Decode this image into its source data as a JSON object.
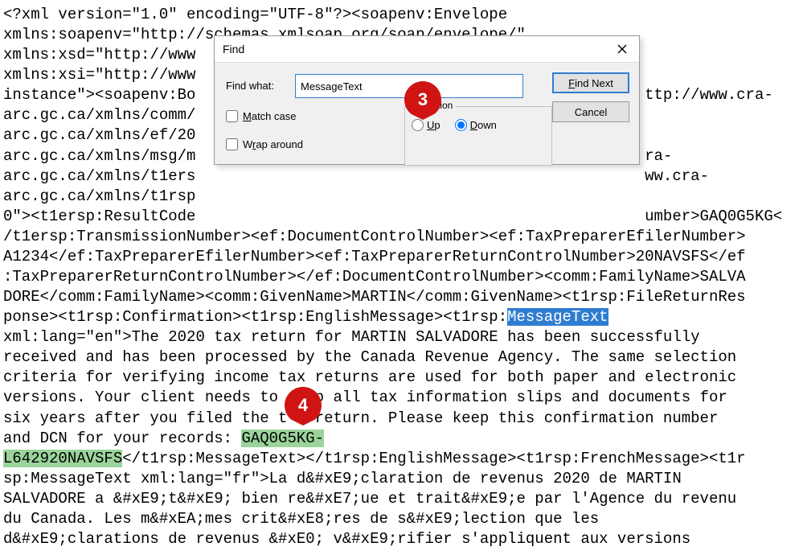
{
  "document_text_pre1": "<?xml version=\"1.0\" encoding=\"UTF-8\"?><soapenv:Envelope\nxmlns:soapenv=\"http://schemas.xmlsoap.org/soap/envelope/\"\nxmlns:xsd=\"http://www\nxmlns:xsi=\"http://www\ninstance\"><soapenv:Bo                                                 ttp://www.cra-\narc.gc.ca/xmlns/comm/\narc.gc.ca/xmlns/ef/20\narc.gc.ca/xmlns/msg/m                                                 ra-\narc.gc.ca/xmlns/t1ers                                                 ww.cra-\narc.gc.ca/xmlns/t1rsp\n0\"><t1ersp:ResultCode                                                 umber>GAQ0G5KG<\n/t1ersp:TransmissionNumber><ef:DocumentControlNumber><ef:TaxPreparerEfilerNumber>\nA1234</ef:TaxPreparerEfilerNumber><ef:TaxPreparerReturnControlNumber>20NAVSFS</ef\n:TaxPreparerReturnControlNumber></ef:DocumentControlNumber><comm:FamilyName>SALVA\nDORE</comm:FamilyName><comm:GivenName>MARTIN</comm:GivenName><t1rsp:FileReturnRes\nponse><t1rsp:Confirmation><t1rsp:EnglishMessage><t1rsp:",
  "highlight_blue": "MessageText",
  "document_text_mid1": "\nxml:lang=\"en\">The 2020 tax return for MARTIN SALVADORE has been successfully\nreceived and has been processed by the Canada Revenue Agency. The same selection\ncriteria for verifying income tax returns are used for both paper and electronic\nversions. Your client needs to    p all tax information slips and documents for\nsix years after you filed the t   return. Please keep this confirmation number\nand DCN for your records: ",
  "highlight_green": "GAQ0G5KG-\nL642920NAVSFS",
  "document_text_post1": "</t1rsp:MessageText></t1rsp:EnglishMessage><t1rsp:FrenchMessage><t1r\nsp:MessageText xml:lang=\"fr\">La d&#xE9;claration de revenus 2020 de MARTIN\nSALVADORE a &#xE9;t&#xE9; bien re&#xE7;ue et trait&#xE9;e par l'Agence du revenu\ndu Canada. Les m&#xEA;mes crit&#xE8;res de s&#xE9;lection que les\nd&#xE9;clarations de revenus &#xE0; v&#xE9;rifier s'appliquent aux versions",
  "find_dialog": {
    "title": "Find",
    "find_what_label": "Find what:",
    "find_what_value": "MessageText",
    "match_case_label": "Match case",
    "wrap_around_label": "Wrap around",
    "direction_label": "Direction",
    "up_label": "Up",
    "down_label": "Down",
    "find_next_pre": "F",
    "find_next_post": "ind Next",
    "cancel_label": "Cancel",
    "direction_value": "down"
  },
  "annotations": {
    "bubble3": "3",
    "bubble4": "4"
  }
}
